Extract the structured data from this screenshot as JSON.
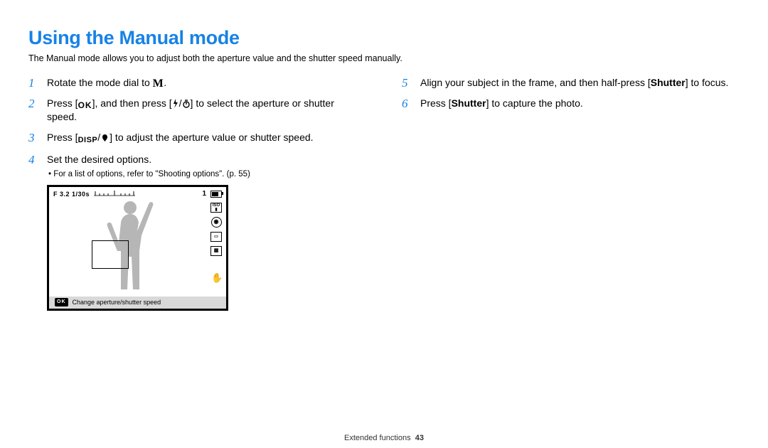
{
  "title": "Using the Manual mode",
  "intro": "The Manual mode allows you to adjust both the aperture value and the shutter speed manually.",
  "steps_left": [
    {
      "n": "1",
      "text_before": "Rotate the mode dial to ",
      "icon": "M",
      "text_after": "."
    },
    {
      "n": "2",
      "text_before": "Press [",
      "icon": "OK",
      "mid": "], and then press [",
      "icon2": "flash/timer",
      "text_after": "] to select the aperture or shutter speed."
    },
    {
      "n": "3",
      "text_before": "Press [",
      "icon": "DISP/macro",
      "text_after": "] to adjust the aperture value or shutter speed."
    },
    {
      "n": "4",
      "text_before": "Set the desired options.",
      "bullet": "For a list of options, refer to \"Shooting options\". (p. 55)"
    }
  ],
  "steps_right": [
    {
      "n": "5",
      "text": "Align your subject in the frame, and then half-press [Shutter] to focus.",
      "bold_words": [
        "Shutter"
      ]
    },
    {
      "n": "6",
      "text": "Press [Shutter] to capture the photo.",
      "bold_words": [
        "Shutter"
      ]
    }
  ],
  "screen": {
    "fvalue": "F 3.2",
    "shutter": "1/30s",
    "exposure_meter": "-2..-1..0..+1..+2",
    "shots_remaining": "1",
    "side_icons": [
      "ISO",
      "metering",
      "AF",
      "size"
    ],
    "stabilizer_icon": "hand",
    "bottom_ok": "OK",
    "bottom_hint": "Change aperture/shutter speed"
  },
  "footer_section": "Extended functions",
  "footer_page": "43"
}
